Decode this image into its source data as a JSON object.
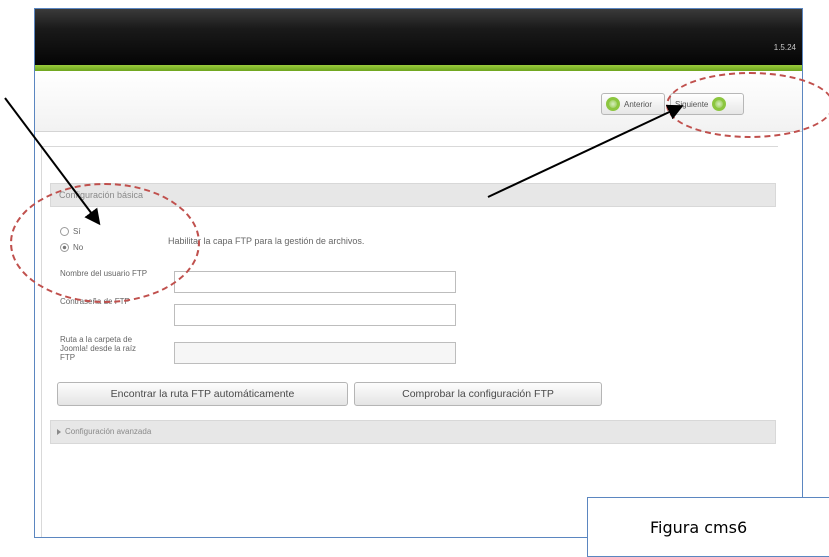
{
  "header": {
    "version": "1.5.24"
  },
  "toolbar": {
    "prev_label": "Anterior",
    "next_label": "Siguiente"
  },
  "basic": {
    "section_title": "Configuración básica",
    "radio_yes": "Sí",
    "radio_no": "No",
    "selected": "No",
    "help_text": "Habilitar la capa FTP para la gestión de archivos.",
    "user_label": "Nombre del usuario FTP",
    "user_value": "",
    "password_label": "Contraseña de FTP",
    "password_value": "",
    "path_label": "Ruta a la carpeta de Joomla! desde la raíz FTP",
    "path_value": "",
    "find_button": "Encontrar la ruta FTP automáticamente",
    "check_button": "Comprobar la configuración FTP"
  },
  "advanced": {
    "section_title": "Configuración avanzada"
  },
  "caption": {
    "text": "Figura cms6"
  },
  "colors": {
    "accent_green": "#8cc63f",
    "annotation_red": "#c0504d",
    "frame_blue": "#5b86c0"
  }
}
